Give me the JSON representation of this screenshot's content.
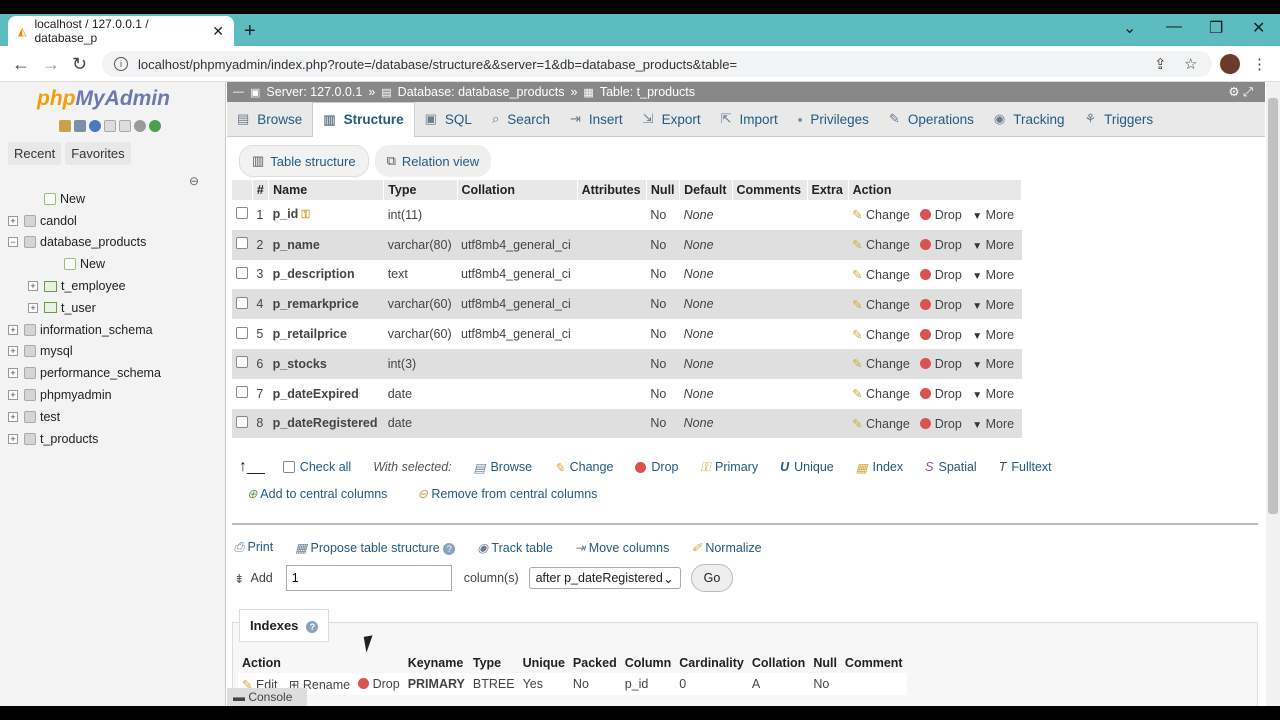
{
  "browser": {
    "tab_title": "localhost / 127.0.0.1 / database_p",
    "url": "localhost/phpmyadmin/index.php?route=/database/structure&&server=1&db=database_products&table="
  },
  "left": {
    "logo_a": "php",
    "logo_b": "MyAdmin",
    "recent": "Recent",
    "favorites": "Favorites",
    "tree": [
      {
        "pm": "",
        "label": "New",
        "indent": 1,
        "kind": "new"
      },
      {
        "pm": "+",
        "label": "candol",
        "indent": 0,
        "kind": "db"
      },
      {
        "pm": "−",
        "label": "database_products",
        "indent": 0,
        "kind": "db"
      },
      {
        "pm": "",
        "label": "New",
        "indent": 2,
        "kind": "new"
      },
      {
        "pm": "+",
        "label": "t_employee",
        "indent": 1,
        "kind": "tbl"
      },
      {
        "pm": "+",
        "label": "t_user",
        "indent": 1,
        "kind": "tbl"
      },
      {
        "pm": "+",
        "label": "information_schema",
        "indent": 0,
        "kind": "db"
      },
      {
        "pm": "+",
        "label": "mysql",
        "indent": 0,
        "kind": "db"
      },
      {
        "pm": "+",
        "label": "performance_schema",
        "indent": 0,
        "kind": "db"
      },
      {
        "pm": "+",
        "label": "phpmyadmin",
        "indent": 0,
        "kind": "db"
      },
      {
        "pm": "+",
        "label": "test",
        "indent": 0,
        "kind": "db"
      },
      {
        "pm": "+",
        "label": "t_products",
        "indent": 0,
        "kind": "db"
      }
    ]
  },
  "crumb": {
    "server": "Server: 127.0.0.1",
    "sep": "»",
    "database": "Database: database_products",
    "table": "Table: t_products"
  },
  "tabs": [
    "Browse",
    "Structure",
    "SQL",
    "Search",
    "Insert",
    "Export",
    "Import",
    "Privileges",
    "Operations",
    "Tracking",
    "Triggers"
  ],
  "subtabs": {
    "table_structure": "Table structure",
    "relation_view": "Relation view"
  },
  "columns_header": [
    "#",
    "Name",
    "Type",
    "Collation",
    "Attributes",
    "Null",
    "Default",
    "Comments",
    "Extra",
    "Action"
  ],
  "rows": [
    {
      "n": "1",
      "name": "p_id",
      "type": "int(11)",
      "collation": "",
      "null": "No",
      "default": "None",
      "key": true
    },
    {
      "n": "2",
      "name": "p_name",
      "type": "varchar(80)",
      "collation": "utf8mb4_general_ci",
      "null": "No",
      "default": "None"
    },
    {
      "n": "3",
      "name": "p_description",
      "type": "text",
      "collation": "utf8mb4_general_ci",
      "null": "No",
      "default": "None"
    },
    {
      "n": "4",
      "name": "p_remarkprice",
      "type": "varchar(60)",
      "collation": "utf8mb4_general_ci",
      "null": "No",
      "default": "None"
    },
    {
      "n": "5",
      "name": "p_retailprice",
      "type": "varchar(60)",
      "collation": "utf8mb4_general_ci",
      "null": "No",
      "default": "None"
    },
    {
      "n": "6",
      "name": "p_stocks",
      "type": "int(3)",
      "collation": "",
      "null": "No",
      "default": "None"
    },
    {
      "n": "7",
      "name": "p_dateExpired",
      "type": "date",
      "collation": "",
      "null": "No",
      "default": "None"
    },
    {
      "n": "8",
      "name": "p_dateRegistered",
      "type": "date",
      "collation": "",
      "null": "No",
      "default": "None"
    }
  ],
  "row_actions": {
    "change": "Change",
    "drop": "Drop",
    "more": "More"
  },
  "with_selected": {
    "check_all": "Check all",
    "label": "With selected:",
    "browse": "Browse",
    "change": "Change",
    "drop": "Drop",
    "primary": "Primary",
    "unique": "Unique",
    "index": "Index",
    "spatial": "Spatial",
    "fulltext": "Fulltext"
  },
  "central": {
    "add": "Add to central columns",
    "remove": "Remove from central columns"
  },
  "tools": {
    "print": "Print",
    "propose": "Propose table structure",
    "track": "Track table",
    "move": "Move columns",
    "normalize": "Normalize"
  },
  "add_row": {
    "label": "Add",
    "value": "1",
    "columns": "column(s)",
    "position": "after p_dateRegistered",
    "go": "Go"
  },
  "indexes": {
    "legend": "Indexes",
    "header": [
      "Action",
      "",
      "",
      "Keyname",
      "Type",
      "Unique",
      "Packed",
      "Column",
      "Cardinality",
      "Collation",
      "Null",
      "Comment"
    ],
    "row": {
      "edit": "Edit",
      "rename": "Rename",
      "drop": "Drop",
      "keyname": "PRIMARY",
      "type": "BTREE",
      "unique": "Yes",
      "packed": "No",
      "column": "p_id",
      "cardinality": "0",
      "collation": "A",
      "null": "No",
      "comment": ""
    }
  },
  "console": "Console"
}
